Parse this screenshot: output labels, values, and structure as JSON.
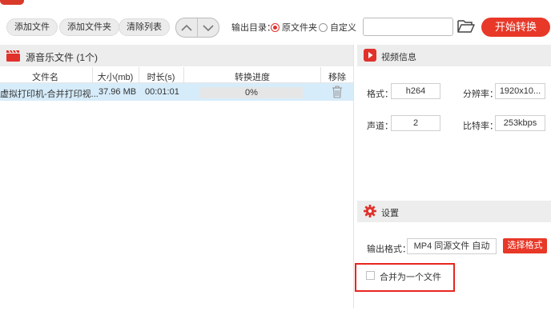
{
  "toolbar": {
    "add_file": "添加文件",
    "add_folder": "添加文件夹",
    "clear_list": "清除列表",
    "output_dir_label": "输出目录：",
    "radio_original": "原文件夹",
    "radio_custom": "自定义",
    "output_path": "",
    "start_convert": "开始转换",
    "selected_output": "原文件夹"
  },
  "file_list": {
    "title": "源音乐文件 (1个)",
    "columns": [
      "文件名",
      "大小(mb)",
      "时长(s)",
      "转换进度",
      "移除"
    ],
    "rows": [
      {
        "name": "虚拟打印机-合并打印视...",
        "size": "37.96 MB",
        "duration": "00:01:01",
        "progress": "0%"
      }
    ]
  },
  "video_info": {
    "title": "视频信息",
    "format_label": "格式：",
    "format_value": "h264",
    "resolution_label": "分辨率：",
    "resolution_value": "1920x10...",
    "channels_label": "声道：",
    "channels_value": "2",
    "bitrate_label": "比特率：",
    "bitrate_value": "253kbps"
  },
  "settings": {
    "title": "设置",
    "output_format_label": "输出格式：",
    "output_format_value": "MP4 同源文件 自动",
    "choose_format": "选择格式",
    "merge_label": "合并为一个文件",
    "merge_checked": false
  },
  "colors": {
    "accent": "#e83828",
    "highlight_box": "#e8261f",
    "row_selected": "#d6ecfa"
  }
}
